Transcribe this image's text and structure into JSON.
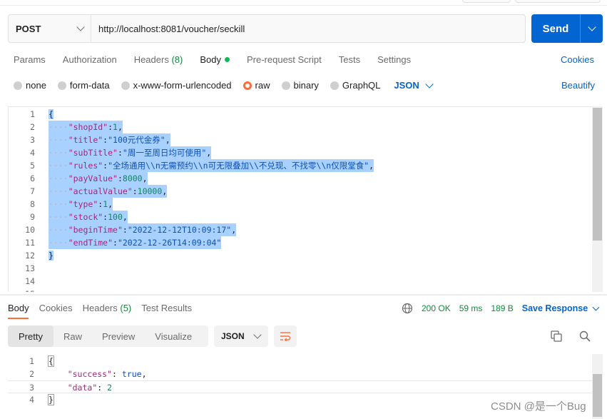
{
  "request": {
    "method": "POST",
    "url": "http://localhost:8081/voucher/seckill",
    "send_label": "Send"
  },
  "request_tabs": {
    "params": "Params",
    "authorization": "Authorization",
    "headers": "Headers",
    "headers_count": "(8)",
    "body": "Body",
    "pre_request": "Pre-request Script",
    "tests": "Tests",
    "settings": "Settings",
    "cookies": "Cookies"
  },
  "body_types": {
    "none": "none",
    "form_data": "form-data",
    "urlencoded": "x-www-form-urlencoded",
    "raw": "raw",
    "binary": "binary",
    "graphql": "GraphQL",
    "format": "JSON",
    "selected": "raw",
    "beautify": "Beautify"
  },
  "editor": {
    "line_numbers": [
      "1",
      "2",
      "3",
      "4",
      "5",
      "6",
      "7",
      "8",
      "9",
      "10",
      "11",
      "12",
      "13",
      "14",
      "15"
    ],
    "l1": "{",
    "shopId_key": "\"shopId\"",
    "shopId_val": "1",
    "title_key": "\"title\"",
    "title_val": "\"100元代金券\"",
    "subTitle_key": "\"subTitle\"",
    "subTitle_val": "\"周一至周日均可使用\"",
    "rules_key": "\"rules\"",
    "rules_val": "\"全场通用\\\\n无需预约\\\\n可无限叠加\\\\不兑现、不找零\\\\n仅限堂食\"",
    "payValue_key": "\"payValue\"",
    "payValue_val": "8000",
    "actualValue_key": "\"actualValue\"",
    "actualValue_val": "10000",
    "type_key": "\"type\"",
    "type_val": "1",
    "stock_key": "\"stock\"",
    "stock_val": "100",
    "beginTime_key": "\"beginTime\"",
    "beginTime_val": "\"2022-12-12T10:09:17\"",
    "endTime_key": "\"endTime\"",
    "endTime_val": "\"2022-12-26T14:09:04\"",
    "l12": "}"
  },
  "response_tabs": {
    "body": "Body",
    "cookies": "Cookies",
    "headers": "Headers",
    "headers_count": "(5)",
    "test_results": "Test Results"
  },
  "response_status": {
    "status": "200 OK",
    "time": "59 ms",
    "size": "189 B",
    "save": "Save Response"
  },
  "response_view": {
    "pretty": "Pretty",
    "raw": "Raw",
    "preview": "Preview",
    "visualize": "Visualize",
    "format": "JSON"
  },
  "response_body": {
    "line_numbers": [
      "1",
      "2",
      "3",
      "4"
    ],
    "open": "{",
    "success_key": "\"success\"",
    "success_val": "true",
    "data_key": "\"data\"",
    "data_val": "2",
    "close": "}"
  },
  "watermark": "CSDN @是一个Bug",
  "colors": {
    "accent": "#ff6c37",
    "primary": "#0265d2",
    "status_ok": "#0f8a3c",
    "selection": "#a8d1ff"
  },
  "icons": [
    "chevron-down-icon",
    "globe-icon",
    "copy-icon",
    "search-icon",
    "wrap-lines-icon"
  ]
}
